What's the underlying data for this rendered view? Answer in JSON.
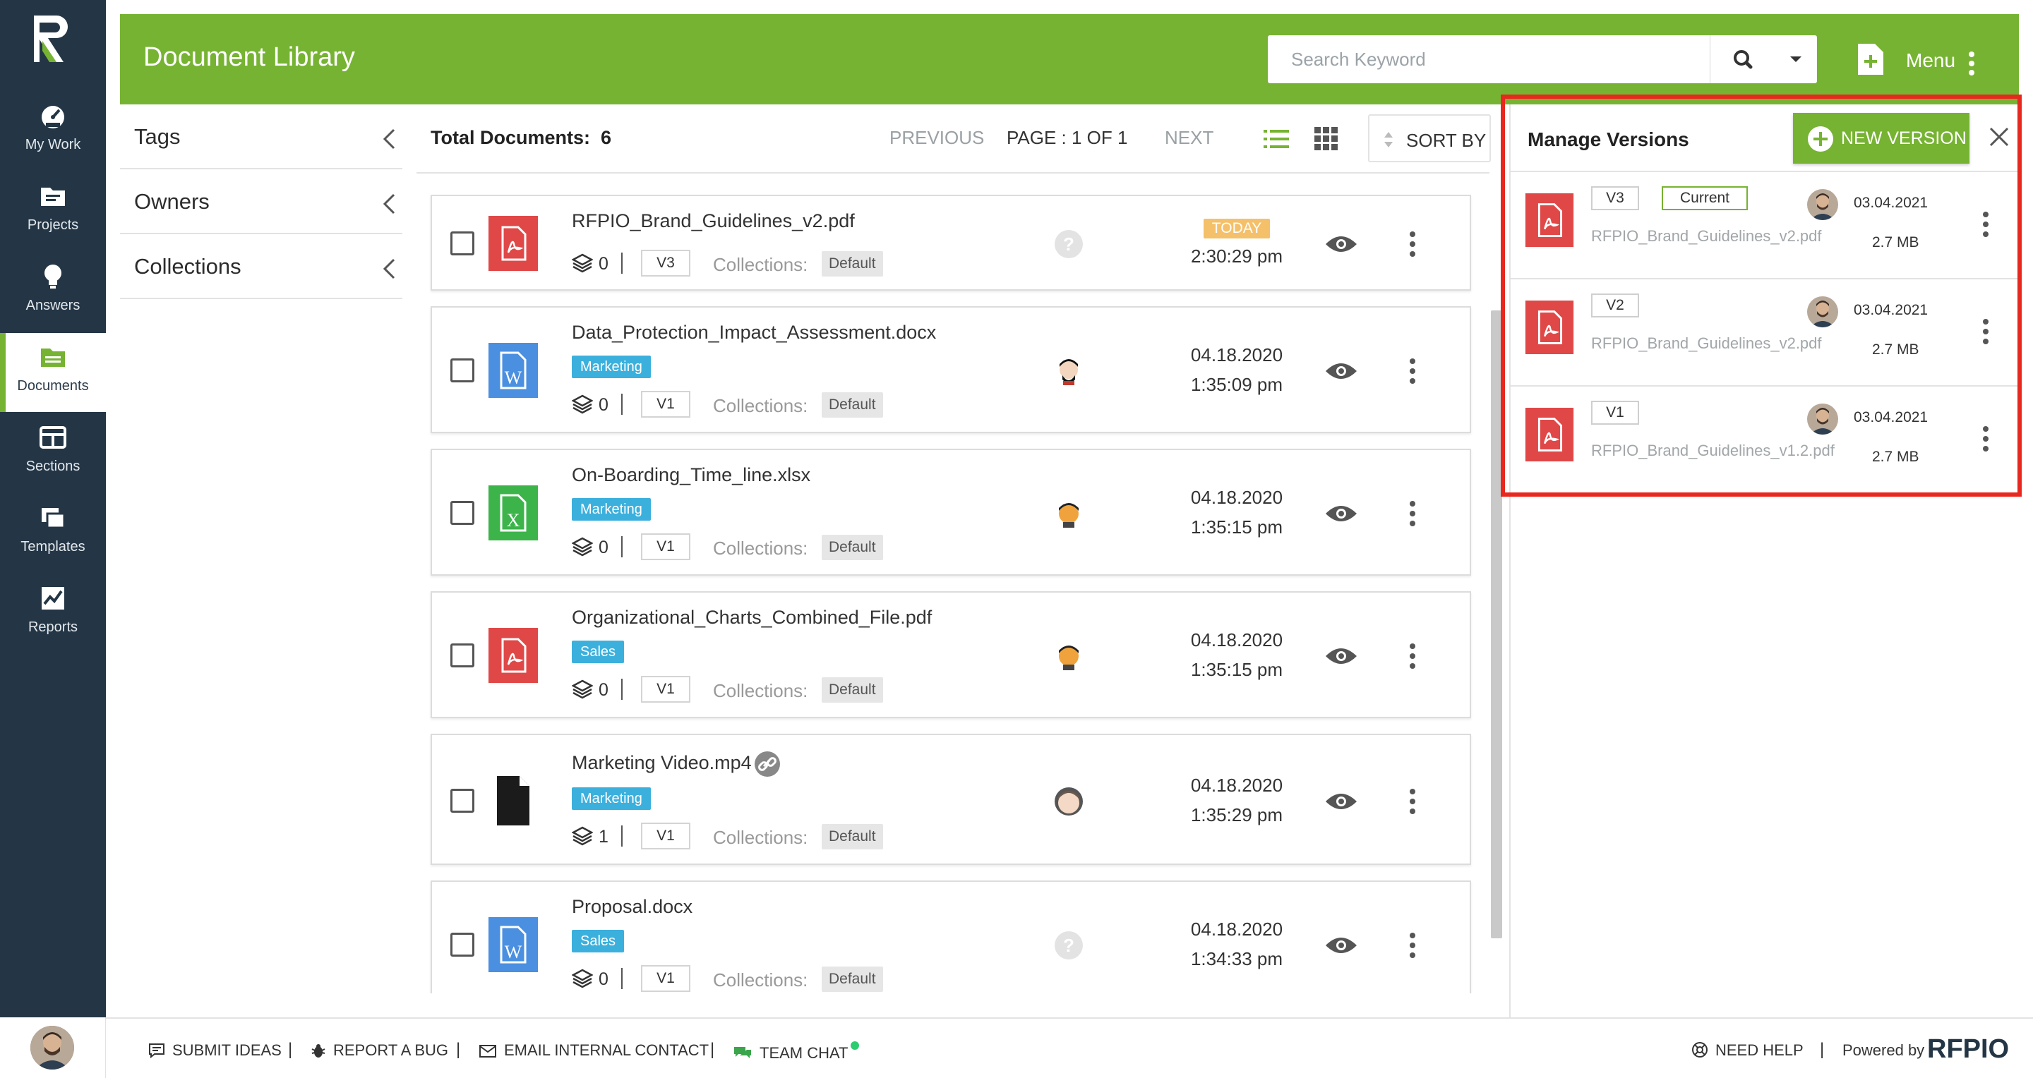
{
  "nav": {
    "items": [
      {
        "label": "My Work",
        "icon": "dashboard-icon"
      },
      {
        "label": "Projects",
        "icon": "folder-icon"
      },
      {
        "label": "Answers",
        "icon": "lightbulb-icon"
      },
      {
        "label": "Documents",
        "icon": "documents-icon"
      },
      {
        "label": "Sections",
        "icon": "sections-icon"
      },
      {
        "label": "Templates",
        "icon": "templates-icon"
      },
      {
        "label": "Reports",
        "icon": "reports-icon"
      }
    ],
    "active": "Documents"
  },
  "header": {
    "title": "Document Library",
    "search_placeholder": "Search Keyword",
    "menu_label": "Menu"
  },
  "filters": [
    {
      "label": "Tags"
    },
    {
      "label": "Owners"
    },
    {
      "label": "Collections"
    }
  ],
  "toolbar": {
    "total_label": "Total Documents:",
    "total_count": "6",
    "previous": "PREVIOUS",
    "page": "PAGE : 1 OF 1",
    "next": "NEXT",
    "sort_by": "SORT BY"
  },
  "documents": [
    {
      "name": "RFPIO_Brand_Guidelines_v2.pdf",
      "type": "pdf",
      "tag": "",
      "count": "0",
      "version": "V3",
      "collections_label": "Collections:",
      "collection": "Default",
      "owner": "unknown",
      "date": "TODAY",
      "time": "2:30:29 pm"
    },
    {
      "name": "Data_Protection_Impact_Assessment.docx",
      "type": "docx",
      "tag": "Marketing",
      "count": "0",
      "version": "V1",
      "collections_label": "Collections:",
      "collection": "Default",
      "owner": "user-a",
      "date": "04.18.2020",
      "time": "1:35:09 pm"
    },
    {
      "name": "On-Boarding_Time_line.xlsx",
      "type": "xlsx",
      "tag": "Marketing",
      "count": "0",
      "version": "V1",
      "collections_label": "Collections:",
      "collection": "Default",
      "owner": "user-b",
      "date": "04.18.2020",
      "time": "1:35:15 pm"
    },
    {
      "name": "Organizational_Charts_Combined_File.pdf",
      "type": "pdf",
      "tag": "Sales",
      "count": "0",
      "version": "V1",
      "collections_label": "Collections:",
      "collection": "Default",
      "owner": "user-b",
      "date": "04.18.2020",
      "time": "1:35:15 pm"
    },
    {
      "name": "Marketing Video.mp4",
      "type": "file",
      "tag": "Marketing",
      "count": "1",
      "version": "V1",
      "collections_label": "Collections:",
      "collection": "Default",
      "owner": "user-c",
      "date": "04.18.2020",
      "time": "1:35:29 pm"
    },
    {
      "name": "Proposal.docx",
      "type": "docx",
      "tag": "Sales",
      "count": "0",
      "version": "V1",
      "collections_label": "Collections:",
      "collection": "Default",
      "owner": "unknown",
      "date": "04.18.2020",
      "time": "1:34:33 pm"
    }
  ],
  "manage_versions": {
    "title": "Manage Versions",
    "new_version": "NEW VERSION",
    "current_label": "Current",
    "versions": [
      {
        "version": "V3",
        "current": true,
        "file": "RFPIO_Brand_Guidelines_v2.pdf",
        "date": "03.04.2021",
        "size": "2.7 MB"
      },
      {
        "version": "V2",
        "current": false,
        "file": "RFPIO_Brand_Guidelines_v2.pdf",
        "date": "03.04.2021",
        "size": "2.7 MB"
      },
      {
        "version": "V1",
        "current": false,
        "file": "RFPIO_Brand_Guidelines_v1.2.pdf",
        "date": "03.04.2021",
        "size": "2.7 MB"
      }
    ]
  },
  "footer": {
    "submit_ideas": "SUBMIT IDEAS",
    "report_bug": "REPORT A BUG",
    "email_contact": "EMAIL INTERNAL CONTACT",
    "team_chat": "TEAM CHAT",
    "need_help": "NEED HELP",
    "powered_by": "Powered by",
    "brand": "RFPIO"
  },
  "colors": {
    "accent": "#76b332",
    "nav_bg": "#243646",
    "tag": "#3bb0dd",
    "pdf": "#e04848",
    "word": "#4a8fe0",
    "excel": "#3cb44a",
    "highlight": "#e8271e"
  }
}
